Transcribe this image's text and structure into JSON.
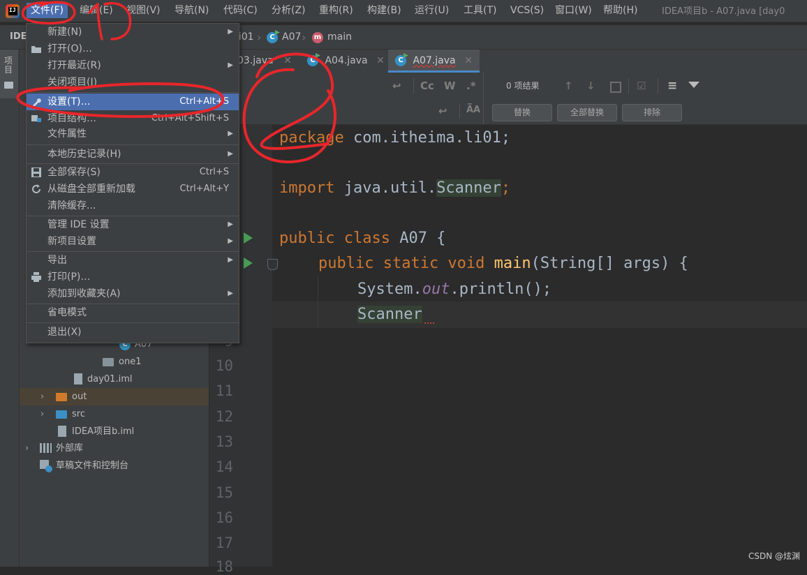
{
  "menubar": {
    "items": [
      "文件(F)",
      "编辑(E)",
      "视图(V)",
      "导航(N)",
      "代码(C)",
      "分析(Z)",
      "重构(R)",
      "构建(B)",
      "运行(U)",
      "工具(T)",
      "VCS(S)",
      "窗口(W)",
      "帮助(H)"
    ],
    "window_title": "IDEA项目b - A07.java [day0"
  },
  "navbar": {
    "crumbs": [
      "li01",
      "A07",
      "main"
    ]
  },
  "tabs": [
    {
      "label": "03.java",
      "icon": "java-class-icon"
    },
    {
      "label": "A04.java",
      "icon": "java-class-icon"
    },
    {
      "label": "A07.java",
      "icon": "java-class-icon",
      "active": true
    }
  ],
  "findbar": {
    "result_text": "0 项结果",
    "toggle_labels": [
      "Cc",
      "W",
      ".*"
    ],
    "buttons": [
      "替换",
      "全部替换",
      "排除"
    ]
  },
  "left_strip": {
    "label": "IDE",
    "project_tab": "项目"
  },
  "tree": [
    {
      "label": "A07",
      "icon": "java-class-icon",
      "indent": 5
    },
    {
      "label": "one1",
      "icon": "package-icon",
      "indent": 5
    },
    {
      "label": "day01.iml",
      "icon": "iml-file-icon",
      "indent": 3
    },
    {
      "label": "out",
      "icon": "folder-orange-icon",
      "indent": 1,
      "expandable": true,
      "highlighted": true
    },
    {
      "label": "src",
      "icon": "folder-blue-icon",
      "indent": 1,
      "expandable": true
    },
    {
      "label": "IDEA项目b.iml",
      "icon": "iml-file-icon",
      "indent": 1
    },
    {
      "label": "外部库",
      "icon": "library-icon",
      "indent": 0,
      "expandable": true
    },
    {
      "label": "草稿文件和控制台",
      "icon": "scratch-icon",
      "indent": 0
    }
  ],
  "editor": {
    "visible_line_numbers": [
      "9",
      "10",
      "11",
      "12",
      "13",
      "14",
      "15",
      "16",
      "17",
      "18"
    ],
    "code": {
      "l1": [
        "package",
        " com.itheima.li01;"
      ],
      "l3": [
        "import",
        " java.util.",
        "Scanner",
        ";"
      ],
      "l5": [
        "public class",
        " A07 {"
      ],
      "l6": [
        "public static void",
        " ",
        "main",
        "(String[] args) {"
      ],
      "l7": [
        "System.",
        "out",
        ".println();"
      ],
      "l8": [
        "Scanner"
      ]
    }
  },
  "file_menu": {
    "items": [
      {
        "label": "新建(N)",
        "submenu": true
      },
      {
        "label": "打开(O)…",
        "icon": "folder-open-icon"
      },
      {
        "label": "打开最近(R)",
        "submenu": true
      },
      {
        "label": "关闭项目(J)"
      },
      {
        "separator": true
      },
      {
        "label": "设置(T)…",
        "shortcut": "Ctrl+Alt+S",
        "icon": "wrench-icon",
        "selected": true
      },
      {
        "label": "项目结构…",
        "shortcut": "Ctrl+Alt+Shift+S",
        "icon": "project-structure-icon"
      },
      {
        "label": "文件属性",
        "submenu": true
      },
      {
        "separator": true
      },
      {
        "label": "本地历史记录(H)",
        "submenu": true
      },
      {
        "separator": true
      },
      {
        "label": "全部保存(S)",
        "shortcut": "Ctrl+S",
        "icon": "save-icon"
      },
      {
        "label": "从磁盘全部重新加载",
        "shortcut": "Ctrl+Alt+Y",
        "icon": "reload-icon"
      },
      {
        "label": "清除缓存..."
      },
      {
        "separator": true
      },
      {
        "label": "管理 IDE 设置",
        "submenu": true
      },
      {
        "label": "新项目设置",
        "submenu": true
      },
      {
        "separator": true
      },
      {
        "label": "导出",
        "submenu": true
      },
      {
        "label": "打印(P)…",
        "icon": "print-icon"
      },
      {
        "label": "添加到收藏夹(A)",
        "submenu": true
      },
      {
        "separator": true
      },
      {
        "label": "省电模式"
      },
      {
        "separator": true
      },
      {
        "label": "退出(X)"
      }
    ]
  },
  "annotations": {
    "watermark": "CSDN @炫渊"
  },
  "colors": {
    "accent": "#4b6eaf",
    "annotation_red": "#e8262b",
    "keyword": "#cc7832",
    "method": "#ffc66d"
  }
}
